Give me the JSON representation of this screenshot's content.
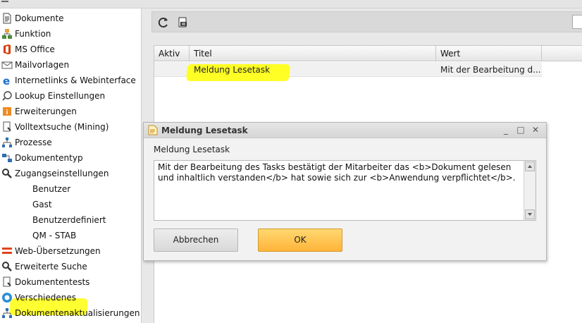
{
  "sidebar": {
    "items": [
      {
        "label": "Dokumente",
        "icon": "document-icon"
      },
      {
        "label": "Funktion",
        "icon": "hierarchy-icon"
      },
      {
        "label": "MS Office",
        "icon": "office-icon"
      },
      {
        "label": "Mailvorlagen",
        "icon": "mail-icon"
      },
      {
        "label": "Internetlinks & Webinterface",
        "icon": "internet-explorer-icon"
      },
      {
        "label": "Lookup Einstellungen",
        "icon": "lookup-icon"
      },
      {
        "label": "Erweiterungen",
        "icon": "info-icon"
      },
      {
        "label": "Volltextsuche (Mining)",
        "icon": "pen-search-icon"
      },
      {
        "label": "Prozesse",
        "icon": "process-icon"
      },
      {
        "label": "Dokumententyp",
        "icon": "document-type-icon"
      },
      {
        "label": "Zugangseinstellungen",
        "icon": "key-search-icon"
      },
      {
        "label": "Benutzer",
        "icon": ""
      },
      {
        "label": "Gast",
        "icon": ""
      },
      {
        "label": "Benutzerdefiniert",
        "icon": ""
      },
      {
        "label": "QM - STAB",
        "icon": ""
      },
      {
        "label": "Web-Übersetzungen",
        "icon": "translation-icon"
      },
      {
        "label": "Erweiterte Suche",
        "icon": "search-icon"
      },
      {
        "label": "Dokumententests",
        "icon": "document-test-icon"
      },
      {
        "label": "Verschiedenes",
        "icon": "misc-icon"
      },
      {
        "label": "Dokumentenaktualisierungen",
        "icon": "document-update-icon"
      }
    ]
  },
  "toolbar": {
    "refresh_icon": "refresh-icon",
    "export_icon": "export-icon"
  },
  "grid": {
    "columns": [
      "Aktiv",
      "Titel",
      "Wert"
    ],
    "rows": [
      {
        "aktiv": "",
        "titel": "Meldung Lesetask",
        "wert": "Mit der Bearbeitung d..."
      }
    ]
  },
  "dialog": {
    "title": "Meldung Lesetask",
    "field_label": "Meldung Lesetask",
    "text_value": "Mit der Bearbeitung des Tasks bestätigt der Mitarbeiter das <b>Dokument gelesen und inhaltlich verstanden</b> hat sowie sich zur <b>Anwendung verpflichtet</b>.",
    "cancel_label": "Abbrechen",
    "ok_label": "OK",
    "min_symbol": "_",
    "max_symbol": "□",
    "close_symbol": "✕"
  },
  "colors": {
    "highlight": "#ffff26",
    "ok_button": "#ffc04a"
  }
}
